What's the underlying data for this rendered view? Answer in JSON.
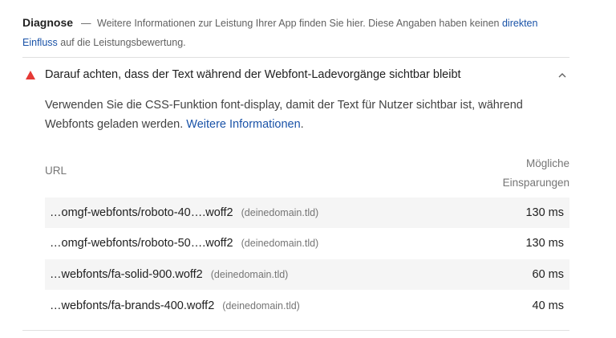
{
  "diagnose": {
    "title": "Diagnose",
    "dash": "—",
    "text_before": "Weitere Informationen zur Leistung Ihrer App finden Sie hier. Diese Angaben haben keinen",
    "link_text": "direkten Einfluss",
    "text_after": "auf die Leistungsbewertung."
  },
  "audit": {
    "title": "Darauf achten, dass der Text während der Webfont-Ladevorgänge sichtbar bleibt",
    "description": "Verwenden Sie die CSS-Funktion font-display, damit der Text für Nutzer sichtbar ist, während Webfonts geladen werden.",
    "link_text": "Weitere Informationen",
    "link_suffix": "."
  },
  "table": {
    "col_url": "URL",
    "col_savings_line1": "Mögliche",
    "col_savings_line2": "Einsparungen",
    "rows": [
      {
        "url": "…omgf-webfonts/roboto-40….woff2",
        "domain": "(deinedomain.tld)",
        "value": "130 ms"
      },
      {
        "url": "…omgf-webfonts/roboto-50….woff2",
        "domain": "(deinedomain.tld)",
        "value": "130 ms"
      },
      {
        "url": "…webfonts/fa-solid-900.woff2",
        "domain": "(deinedomain.tld)",
        "value": "60 ms"
      },
      {
        "url": "…webfonts/fa-brands-400.woff2",
        "domain": "(deinedomain.tld)",
        "value": "40 ms"
      }
    ]
  },
  "colors": {
    "warning": "#e53935",
    "link": "#1a53a8",
    "row_shade": "#f5f5f5"
  },
  "icons": {
    "warning": "warning-triangle-icon",
    "expand": "chevron-up-icon"
  }
}
